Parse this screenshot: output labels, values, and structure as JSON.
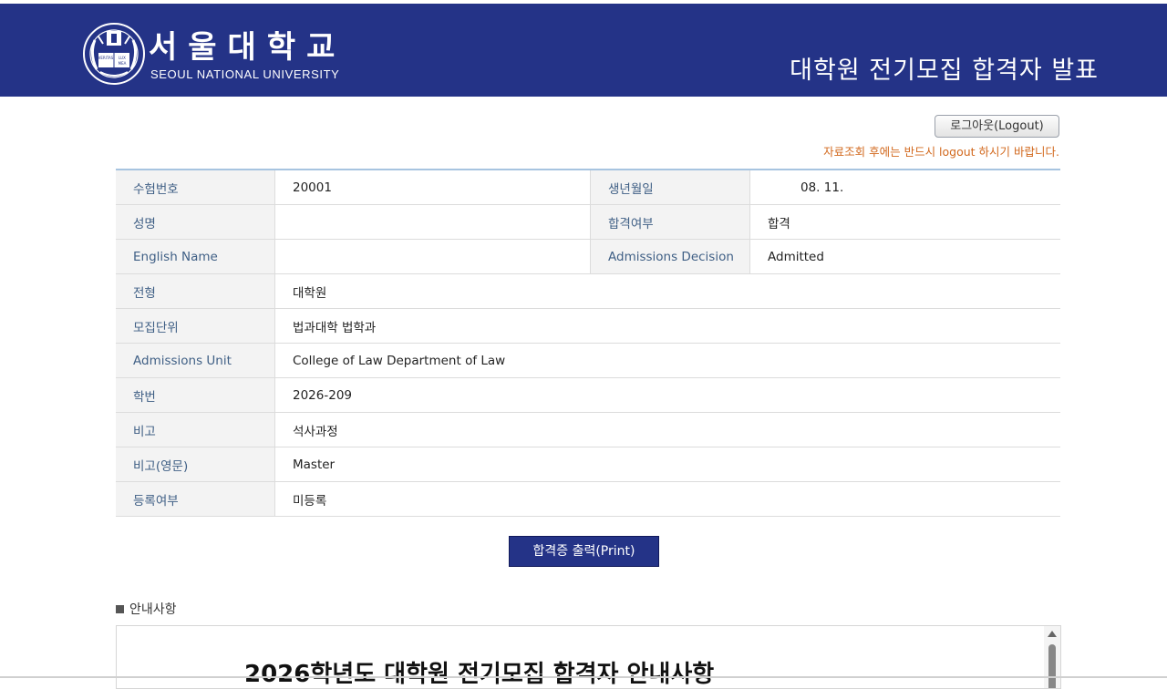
{
  "header": {
    "univ_name_ko": "서울대학교",
    "univ_name_en": "SEOUL NATIONAL UNIVERSITY",
    "page_title": "대학원 전기모집 합격자 발표",
    "logo_book_text": [
      "VERITAS",
      "LUX",
      "MEA"
    ],
    "bg_color": "#243387"
  },
  "session": {
    "logout_label": "로그아웃(Logout)",
    "logout_note": "자료조회 후에는 반드시 logout 하시기 바랍니다."
  },
  "info": {
    "exam_no_label": "수험번호",
    "exam_no_value": "20001",
    "birth_label": "생년월일",
    "birth_value": "08. 11.",
    "name_label": "성명",
    "name_value": "",
    "result_label": "합격여부",
    "result_value": "합격",
    "english_name_label": "English Name",
    "english_name_value": "",
    "decision_label": "Admissions Decision",
    "decision_value": "Admitted",
    "track_label": "전형",
    "track_value": "대학원",
    "unit_label": "모집단위",
    "unit_value": "법과대학 법학과",
    "unit_en_label": "Admissions Unit",
    "unit_en_value": "College of Law Department of Law",
    "student_no_label": "학번",
    "student_no_value": "2026-209",
    "remark_label": "비고",
    "remark_value": "석사과정",
    "remark_en_label": "비고(영문)",
    "remark_en_value": "Master",
    "enroll_label": "등록여부",
    "enroll_value": "미등록"
  },
  "actions": {
    "print_label": "합격증 출력(Print)"
  },
  "notice": {
    "heading": "안내사항",
    "title_partial": "2026학년도 대학원 전기모집 합격자 안내사항"
  }
}
